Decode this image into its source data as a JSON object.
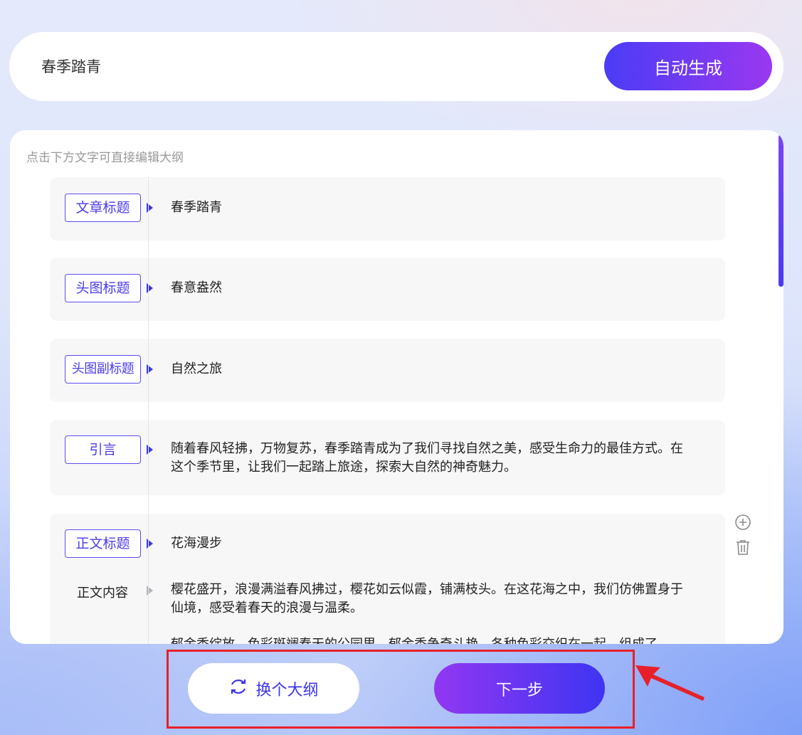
{
  "search": {
    "topic": "春季踏青",
    "generate_label": "自动生成"
  },
  "outline": {
    "hint": "点击下方文字可直接编辑大纲",
    "rows": [
      {
        "tag": "文章标题",
        "text": "春季踏青"
      },
      {
        "tag": "头图标题",
        "text": "春意盎然"
      },
      {
        "tag": "头图副标题",
        "text": "自然之旅"
      },
      {
        "tag": "引言",
        "text": "随着春风轻拂，万物复苏，春季踏青成为了我们寻找自然之美，感受生命力的最佳方式。在这个季节里，让我们一起踏上旅途，探索大自然的神奇魅力。"
      },
      {
        "tag": "正文标题",
        "text": "花海漫步",
        "body_label": "正文内容",
        "body_text": "樱花盛开，浪漫满溢春风拂过，樱花如云似霞，铺满枝头。在这花海之中，我们仿佛置身于仙境，感受着春天的浪漫与温柔。",
        "body_text_2": "郁金香绽放，色彩斑斓春天的公园里，郁金香争奇斗艳，各种色彩交织在一起，组成了"
      }
    ]
  },
  "icons": {
    "add": "plus-circle-icon",
    "delete": "trash-icon",
    "refresh": "refresh-icon"
  },
  "actions": {
    "change_outline_label": "换个大纲",
    "next_label": "下一步"
  },
  "colors": {
    "accent": "#4a3cf5",
    "gradient_end": "#9a38f0",
    "annotation": "#e8202a"
  }
}
